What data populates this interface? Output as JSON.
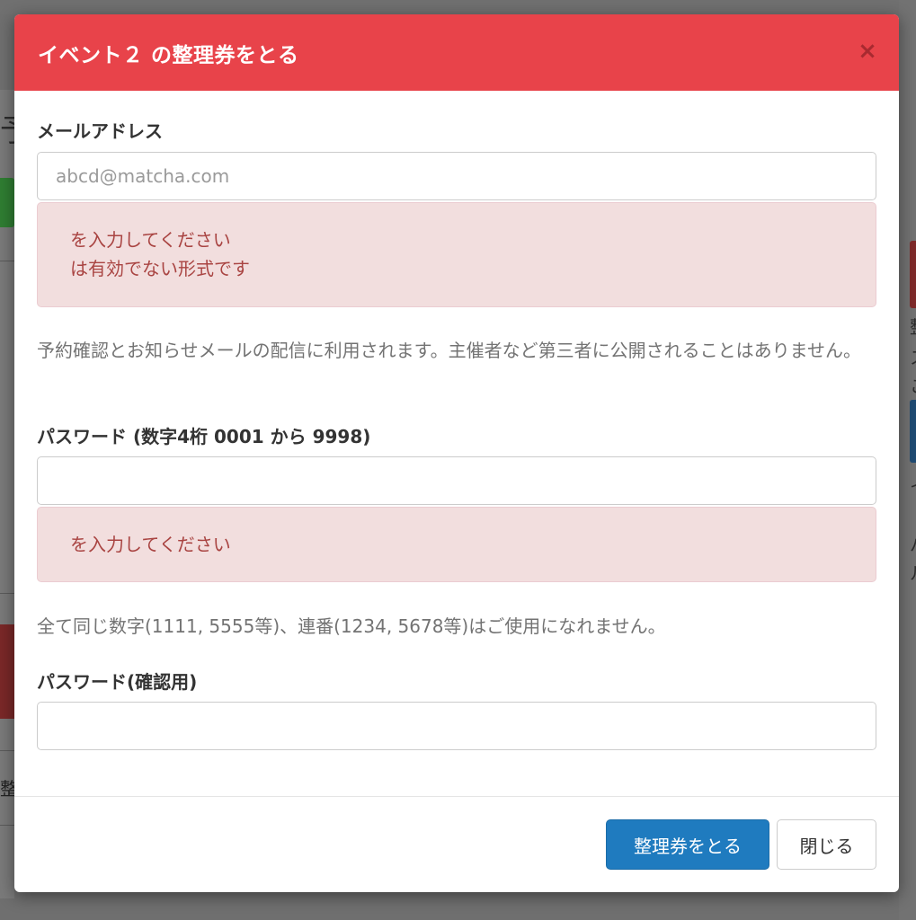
{
  "modal": {
    "title": "イベント２ の整理券をとる",
    "close_symbol": "×"
  },
  "email": {
    "label": "メールアドレス",
    "placeholder": "abcd@matcha.com",
    "value": "",
    "errors": [
      "を入力してください",
      "は有効でない形式です"
    ],
    "help": "予約確認とお知らせメールの配信に利用されます。主催者など第三者に公開されることはありません。"
  },
  "password": {
    "label": "パスワード (数字4桁 0001 から 9998)",
    "value": "",
    "errors": [
      "を入力してください"
    ],
    "help": "全て同じ数字(1111, 5555等)、連番(1234, 5678等)はご使用になれません。"
  },
  "password_confirm": {
    "label": "パスワード(確認用)",
    "value": ""
  },
  "footer": {
    "submit_label": "整理券をとる",
    "close_label": "閉じる"
  },
  "background": {
    "left_char_top": "予",
    "left_char_bottom": "整",
    "right_chars": [
      "整",
      "ス",
      "こ",
      "イ",
      "パ",
      "ル"
    ]
  },
  "colors": {
    "header": "#e8434a",
    "primary_button": "#1f7bbf",
    "alert_bg": "#f2dede",
    "alert_text": "#a94442"
  }
}
